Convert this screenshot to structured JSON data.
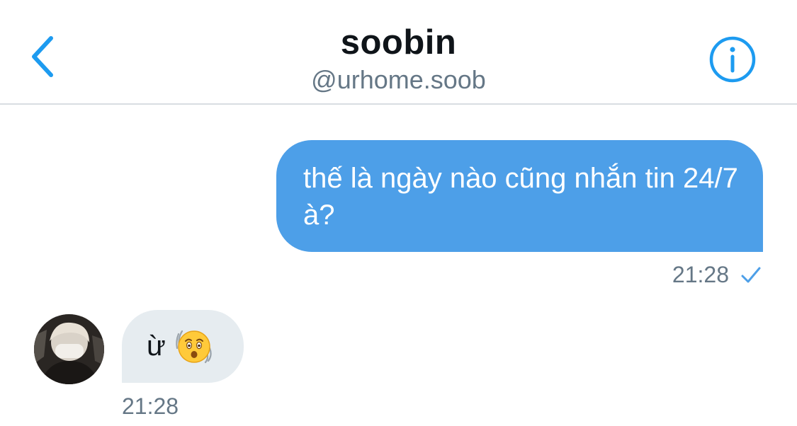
{
  "header": {
    "title": "soobin",
    "handle": "@urhome.soob",
    "back_icon": "chevron-left-icon",
    "info_icon": "info-icon",
    "accent_color": "#1d9bf0"
  },
  "messages": {
    "outgoing": {
      "text": "thế là ngày nào cũng nhắn tin 24/7 à?",
      "time": "21:28",
      "status_icon": "checkmark-icon",
      "bubble_color": "#4d9fe8"
    },
    "incoming": {
      "text": "ừ",
      "emoji": "hushed-face-emoji",
      "time": "21:28",
      "bubble_color": "#e6ecf0"
    }
  }
}
